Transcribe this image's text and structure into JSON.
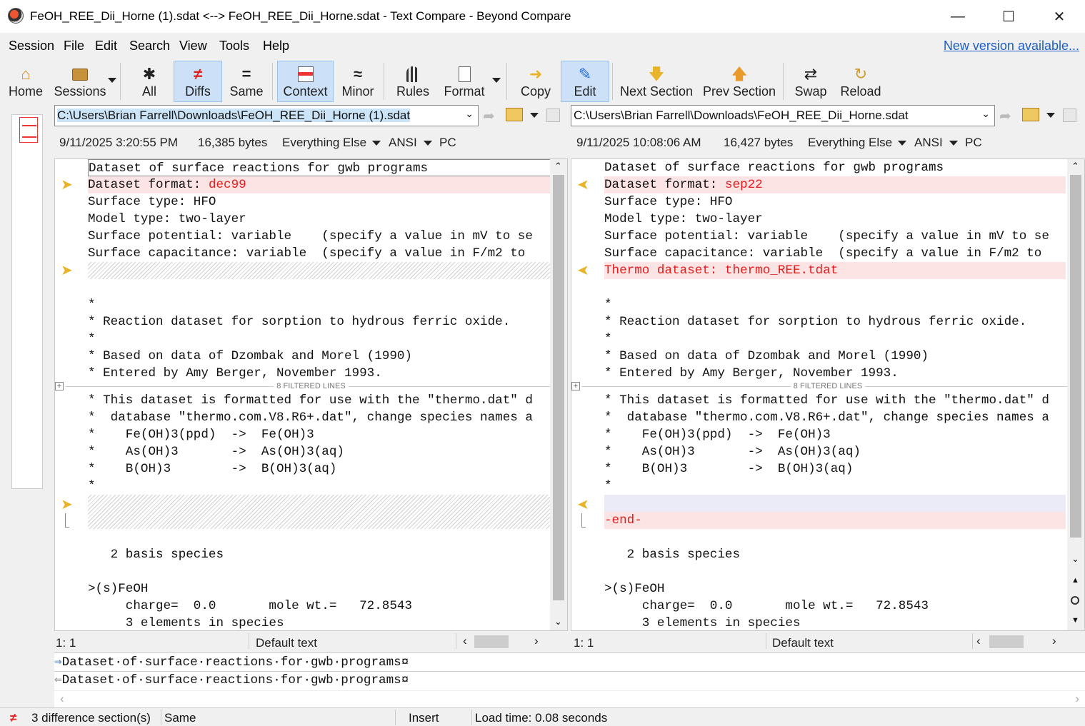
{
  "window": {
    "title": "FeOH_REE_Dii_Horne (1).sdat <--> FeOH_REE_Dii_Horne.sdat - Text Compare - Beyond Compare",
    "minimize": "—",
    "maximize": "☐",
    "close": "✕"
  },
  "menu": {
    "items": [
      "Session",
      "File",
      "Edit",
      "Search",
      "View",
      "Tools",
      "Help"
    ],
    "new_version": "New version available..."
  },
  "toolbar": {
    "home": "Home",
    "sessions": "Sessions",
    "all": "All",
    "diffs": "Diffs",
    "same": "Same",
    "context": "Context",
    "minor": "Minor",
    "rules": "Rules",
    "format": "Format",
    "copy": "Copy",
    "edit": "Edit",
    "next_section": "Next Section",
    "prev_section": "Prev Section",
    "swap": "Swap",
    "reload": "Reload"
  },
  "left": {
    "path": "C:\\Users\\Brian Farrell\\Downloads\\FeOH_REE_Dii_Horne (1).sdat",
    "date": "9/11/2025 3:20:55 PM",
    "size": "16,385 bytes",
    "format": "Everything Else",
    "encoding": "ANSI",
    "lineend": "PC",
    "lines": [
      "Dataset of surface reactions for gwb programs",
      "Dataset format: ",
      "dec99",
      "Surface type: HFO",
      "Model type: two-layer",
      "Surface potential: variable    (specify a value in mV to se",
      "Surface capacitance: variable  (specify a value in F/m2 to ",
      "*",
      "* Reaction dataset for sorption to hydrous ferric oxide.",
      "*",
      "* Based on data of Dzombak and Morel (1990)",
      "* Entered by Amy Berger, November 1993.",
      "* This dataset is formatted for use with the \"thermo.dat\" d",
      "*  database \"thermo.com.V8.R6+.dat\", change species names a",
      "*    Fe(OH)3(ppd)  ->  Fe(OH)3",
      "*    As(OH)3       ->  As(OH)3(aq)",
      "*    B(OH)3        ->  B(OH)3(aq)",
      "*",
      "   2 basis species",
      ">(s)FeOH",
      "     charge=  0.0       mole wt.=   72.8543",
      "     3 elements in species"
    ],
    "cursor": "1: 1",
    "syntax": "Default text"
  },
  "right": {
    "path": "C:\\Users\\Brian Farrell\\Downloads\\FeOH_REE_Dii_Horne.sdat",
    "date": "9/11/2025 10:08:06 AM",
    "size": "16,427 bytes",
    "format": "Everything Else",
    "encoding": "ANSI",
    "lineend": "PC",
    "lines": [
      "Dataset of surface reactions for gwb programs",
      "Dataset format: ",
      "sep22",
      "Surface type: HFO",
      "Model type: two-layer",
      "Surface potential: variable    (specify a value in mV to se",
      "Surface capacitance: variable  (specify a value in F/m2 to ",
      "Thermo dataset: thermo_REE.tdat",
      "*",
      "* Reaction dataset for sorption to hydrous ferric oxide.",
      "*",
      "* Based on data of Dzombak and Morel (1990)",
      "* Entered by Amy Berger, November 1993.",
      "* This dataset is formatted for use with the \"thermo.dat\" d",
      "*  database \"thermo.com.V8.R6+.dat\", change species names a",
      "*    Fe(OH)3(ppd)  ->  Fe(OH)3",
      "*    As(OH)3       ->  As(OH)3(aq)",
      "*    B(OH)3        ->  B(OH)3(aq)",
      "*",
      "-end-",
      "   2 basis species",
      ">(s)FeOH",
      "     charge=  0.0       mole wt.=   72.8543",
      "     3 elements in species"
    ],
    "cursor": "1: 1",
    "syntax": "Default text"
  },
  "filtered_label": "8 FILTERED LINES",
  "bottom": {
    "line1": "Dataset·of·surface·reactions·for·gwb·programs¤",
    "line2": "Dataset·of·surface·reactions·for·gwb·programs¤"
  },
  "status": {
    "diffs": "3 difference section(s)",
    "same": "Same",
    "insert": "Insert",
    "load": "Load time: 0.08 seconds"
  },
  "colors": {
    "diff_bg": "#fde4e4",
    "diff_text": "#e41b1b",
    "accent": "#cce1f7"
  }
}
